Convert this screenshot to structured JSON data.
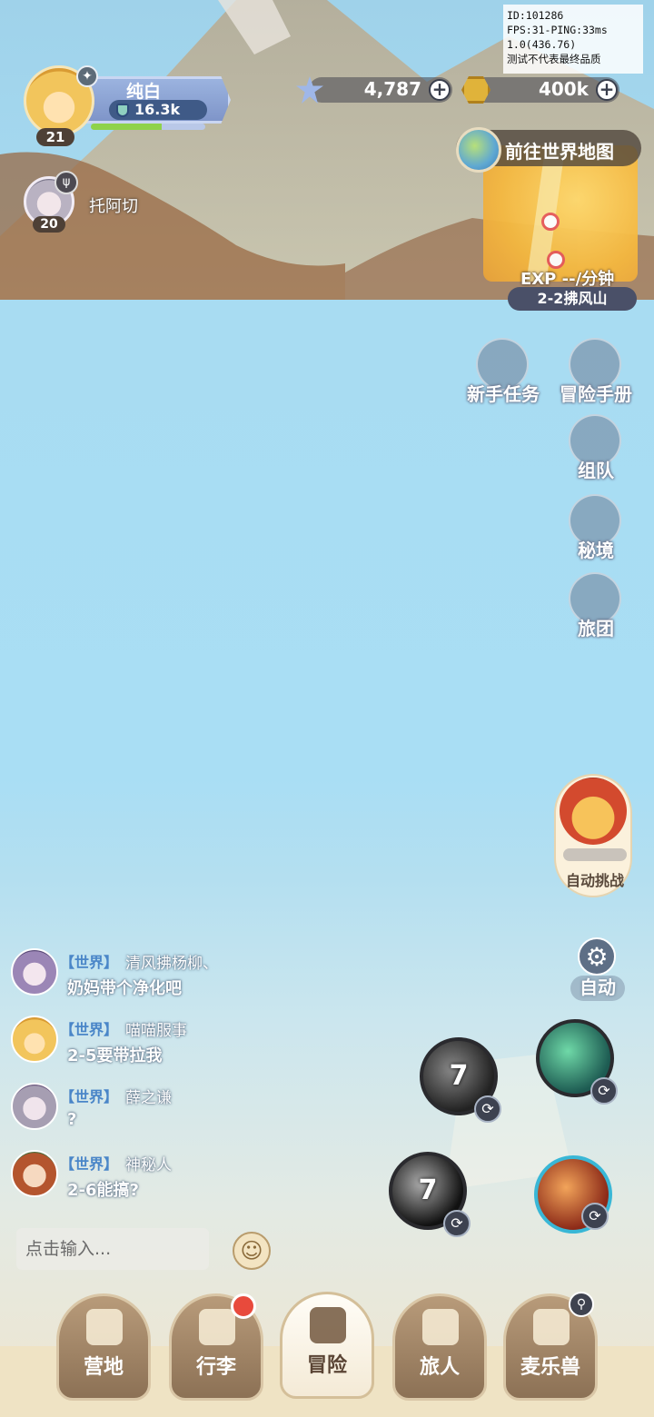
{
  "debug": {
    "line1": "ID:101286",
    "line2": "FPS:31-PING:33ms",
    "line3": "1.0(436.76)",
    "line4": "测试不代表最终品质"
  },
  "player": {
    "name": "纯白",
    "power": "16.3k",
    "level": "21",
    "xp_fraction": 0.62
  },
  "currency": {
    "crystal": "4,787",
    "coin": "400k"
  },
  "teammate": {
    "name": "托阿切",
    "level": "20"
  },
  "map": {
    "world_map_label": "前往世界地图",
    "exp_rate": "EXP --/分钟",
    "stage": "2-2拂风山"
  },
  "right_menu": [
    {
      "label": "新手任务",
      "icon": "flag-shield-icon"
    },
    {
      "label": "冒险手册",
      "icon": "book-icon"
    },
    {
      "label": "组队",
      "icon": "team-flag-icon"
    },
    {
      "label": "秘境",
      "icon": "eye-icon"
    },
    {
      "label": "旅团",
      "icon": "guild-shield-icon"
    }
  ],
  "auto_challenge": {
    "label": "自动挑战"
  },
  "auto_toggle": {
    "label": "自动"
  },
  "skills": [
    {
      "cd": "7",
      "icon": "dark-slash-skill-icon"
    },
    {
      "cd": "",
      "icon": "wind-blade-skill-icon"
    },
    {
      "cd": "7",
      "icon": "moon-slash-skill-icon"
    },
    {
      "cd": "",
      "icon": "fire-burst-skill-icon"
    }
  ],
  "chat": {
    "messages": [
      {
        "channel": "【世界】",
        "sender": "清风拂杨柳、",
        "text": "奶妈带个净化吧"
      },
      {
        "channel": "【世界】",
        "sender": "喵喵服事",
        "text": "2-5要带拉我"
      },
      {
        "channel": "【世界】",
        "sender": "薛之谦",
        "text": "?"
      },
      {
        "channel": "【世界】",
        "sender": "神秘人",
        "text": "2-6能搞?"
      }
    ],
    "input_placeholder": "点击输入..."
  },
  "nav": {
    "tabs": [
      {
        "label": "营地",
        "icon": "camp-castle-icon",
        "active": false
      },
      {
        "label": "行李",
        "icon": "backpack-icon",
        "active": false
      },
      {
        "label": "冒险",
        "icon": "crossed-swords-icon",
        "active": true
      },
      {
        "label": "旅人",
        "icon": "traveler-portrait-icon",
        "active": false
      },
      {
        "label": "麦乐兽",
        "icon": "pet-cat-icon",
        "active": false
      }
    ]
  },
  "colors": {
    "sky": "#a9def4",
    "nav_bg": "#efe3c4",
    "chat_channel": "#4a86c8",
    "badge_red": "#e84a3c"
  }
}
